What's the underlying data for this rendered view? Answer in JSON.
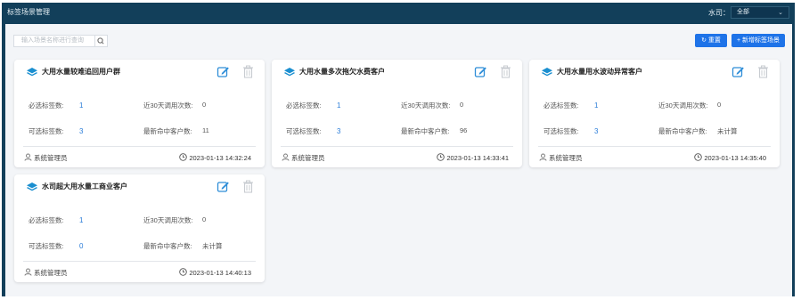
{
  "window": {
    "title": "标签场景管理"
  },
  "filter": {
    "company_label": "水司：",
    "company_value": "全部"
  },
  "toolbar": {
    "search_placeholder": "输入场景名称进行查询",
    "reset_label": "重置",
    "add_label": "新增标签场景"
  },
  "labels": {
    "required": "必选标签数:",
    "optional": "可选标签数:",
    "calls30": "近30天调用次数:",
    "latest_hits": "最新命中客户数:"
  },
  "cards": [
    {
      "name": "大用水量较难追回用户群",
      "required": "1",
      "optional": "3",
      "calls30": "0",
      "hits": "11",
      "owner": "系统管理员",
      "time": "2023-01-13 14:32:24"
    },
    {
      "name": "大用水量多次拖欠水费客户",
      "required": "1",
      "optional": "3",
      "calls30": "0",
      "hits": "96",
      "owner": "系统管理员",
      "time": "2023-01-13 14:33:41"
    },
    {
      "name": "大用水量用水波动异常客户",
      "required": "1",
      "optional": "3",
      "calls30": "0",
      "hits": "未计算",
      "owner": "系统管理员",
      "time": "2023-01-13 14:35:40"
    },
    {
      "name": "水司超大用水量工商业客户",
      "required": "1",
      "optional": "0",
      "calls30": "0",
      "hits": "未计算",
      "owner": "系统管理员",
      "time": "2023-01-13 14:40:13"
    }
  ],
  "colors": {
    "header": "#123f5a",
    "primary": "#1e73e8",
    "link": "#2a7cd8",
    "icon": "#1b8fd0"
  }
}
